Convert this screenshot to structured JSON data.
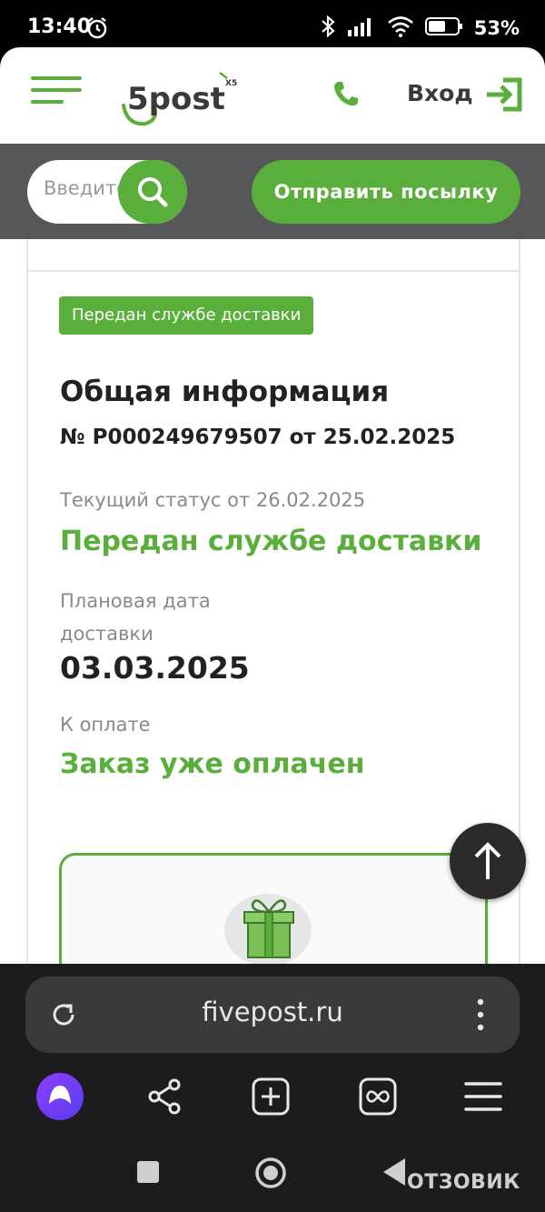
{
  "status_bar": {
    "time": "13:40",
    "battery": "53%"
  },
  "header": {
    "logo_text": "5post",
    "logo_badge": "X5",
    "login_label": "Вход"
  },
  "search": {
    "placeholder": "Введите",
    "send_button": "Отправить посылку"
  },
  "order": {
    "badge": "Передан службе доставки",
    "section_title": "Общая информация",
    "number_line": "№ P000249679507 от 25.02.2025",
    "status_caption": "Текущий статус от 26.02.2025",
    "status_value": "Передан службе доставки",
    "delivery_caption": "Плановая дата доставки",
    "delivery_value": "03.03.2025",
    "payment_caption": "К оплате",
    "payment_value": "Заказ уже оплачен"
  },
  "browser": {
    "url": "fivepost.ru"
  },
  "watermark": "ОТЗОВИК",
  "colors": {
    "brand_green": "#5aae3c",
    "strip_gray": "#555759",
    "browser_dark": "#1c1c1e"
  }
}
